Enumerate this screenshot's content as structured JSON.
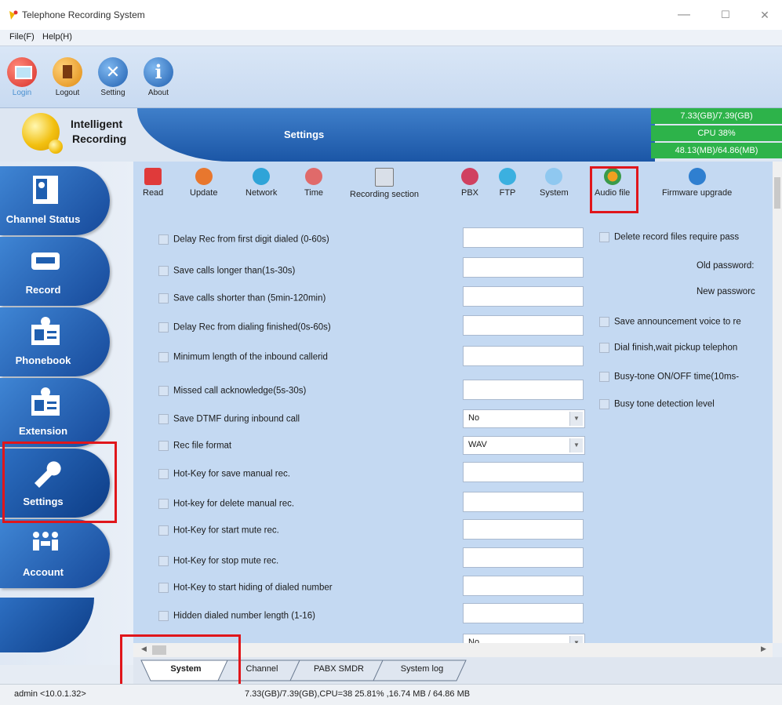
{
  "window": {
    "title": "Telephone Recording System"
  },
  "menu": [
    "File(F)",
    "Help(H)"
  ],
  "toolbar": [
    {
      "label": "Login",
      "icon": "login-icon"
    },
    {
      "label": "Logout",
      "icon": "logout-icon"
    },
    {
      "label": "Setting",
      "icon": "setting-icon"
    },
    {
      "label": "About",
      "icon": "about-icon"
    }
  ],
  "banner": {
    "brand_line1": "Intelligent",
    "brand_line2": "Recording",
    "section_title": "Settings",
    "stats": [
      "7.33(GB)/7.39(GB)",
      "CPU 38%",
      "48.13(MB)/64.86(MB)"
    ]
  },
  "sidebar": [
    {
      "label": "Channel Status",
      "icon": "channel-status-icon"
    },
    {
      "label": "Record",
      "icon": "record-icon"
    },
    {
      "label": "Phonebook",
      "icon": "phonebook-icon"
    },
    {
      "label": "Extension",
      "icon": "extension-icon"
    },
    {
      "label": "Settings",
      "icon": "settings-icon",
      "active": true
    },
    {
      "label": "Account",
      "icon": "account-icon"
    }
  ],
  "settings_toolbar": [
    {
      "label": "Read",
      "color": "#e03a3a"
    },
    {
      "label": "Update",
      "color": "#e8772e"
    },
    {
      "label": "Network",
      "color": "#2fa4d8"
    },
    {
      "label": "Time",
      "color": "#e06a6a"
    },
    {
      "label": "Recording section",
      "color": "#7a7a7a"
    },
    {
      "label": "PBX",
      "color": "#d04060"
    },
    {
      "label": "FTP",
      "color": "#3bb0e0"
    },
    {
      "label": "System",
      "color": "#8fc8f0"
    },
    {
      "label": "Audio file",
      "color": "#3a9a4a"
    },
    {
      "label": "Firmware upgrade",
      "color": "#2f7fd0"
    }
  ],
  "settings_left": [
    {
      "label": "Delay Rec from first digit dialed (0-60s)",
      "control": "input",
      "value": ""
    },
    {
      "label": "Save calls longer than(1s-30s)",
      "control": "input",
      "value": ""
    },
    {
      "label": "Save calls shorter than (5min-120min)",
      "control": "input",
      "value": ""
    },
    {
      "label": "Delay Rec from dialing finished(0s-60s)",
      "control": "input",
      "value": ""
    },
    {
      "label": "Minimum length of the inbound callerid",
      "control": "input",
      "value": ""
    },
    {
      "label": "Missed call acknowledge(5s-30s)",
      "control": "input",
      "value": ""
    },
    {
      "label": "Save DTMF during inbound call",
      "control": "select",
      "value": "No"
    },
    {
      "label": "Rec file format",
      "control": "select",
      "value": "WAV"
    },
    {
      "label": "Hot-Key for save manual rec.",
      "control": "input",
      "value": ""
    },
    {
      "label": "Hot-key for delete manual rec.",
      "control": "input",
      "value": ""
    },
    {
      "label": "Hot-Key for start mute rec.",
      "control": "input",
      "value": ""
    },
    {
      "label": "Hot-Key for stop mute rec.",
      "control": "input",
      "value": ""
    },
    {
      "label": "Hot-Key to start hiding of dialed number",
      "control": "input",
      "value": ""
    },
    {
      "label": "Hidden dialed number length (1-16)",
      "control": "input",
      "value": ""
    },
    {
      "label": "",
      "control": "select",
      "value": "No"
    }
  ],
  "settings_right": {
    "delete_require_pass": "Delete record files require pass",
    "old_password": "Old password:",
    "new_password": "New passworc",
    "save_announcement": "Save announcement voice to re",
    "dial_finish": "Dial finish,wait pickup telephon",
    "busy_tone_time": "Busy-tone ON/OFF time(10ms-",
    "busy_tone_level": "Busy tone detection level"
  },
  "tabs": [
    "System",
    "Channel",
    "PABX SMDR",
    "System log"
  ],
  "status": {
    "user": "admin <10.0.1.32>",
    "info": "7.33(GB)/7.39(GB),CPU=38 25.81% ,16.74 MB / 64.86 MB"
  }
}
